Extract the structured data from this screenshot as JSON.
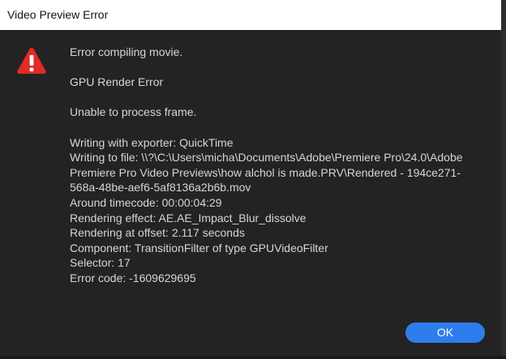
{
  "window": {
    "title": "Video Preview Error"
  },
  "icon": {
    "name": "warning-icon",
    "color": "#e02b27"
  },
  "message": {
    "line1": "Error compiling movie.",
    "line2": "GPU Render Error",
    "line3": "Unable to process frame.",
    "line4": "Writing with exporter: QuickTime",
    "line5": "Writing to file: \\\\?\\C:\\Users\\micha\\Documents\\Adobe\\Premiere Pro\\24.0\\Adobe Premiere Pro Video Previews\\how alchol is made.PRV\\Rendered - 194ce271-568a-48be-aef6-5af8136a2b6b.mov",
    "line6": "Around timecode: 00:00:04:29",
    "line7": "Rendering effect: AE.AE_Impact_Blur_dissolve",
    "line8": "Rendering at offset: 2.117 seconds",
    "line9": "Component: TransitionFilter of type GPUVideoFilter",
    "line10": "Selector: 17",
    "line11": "Error code: -1609629695"
  },
  "buttons": {
    "ok_label": "OK",
    "ok_color": "#2e7ded"
  }
}
